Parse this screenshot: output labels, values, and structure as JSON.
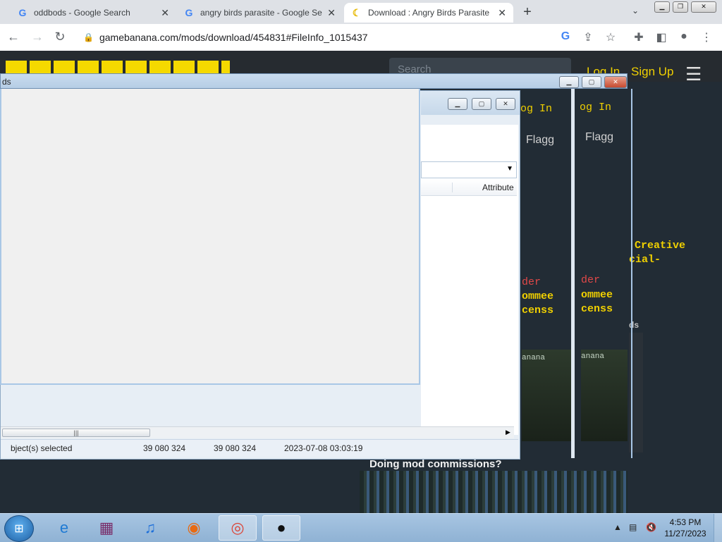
{
  "browser": {
    "tabs": [
      {
        "title": "oddbods - Google Search",
        "icon": "google-icon"
      },
      {
        "title": "angry birds parasite - Google Se",
        "icon": "google-icon"
      },
      {
        "title": "Download : Angry Birds Parasite",
        "icon": "banana-icon"
      }
    ],
    "new_tab": "+",
    "url": "gamebanana.com/mods/download/454831#FileInfo_1015437"
  },
  "page": {
    "search_placeholder": "Search",
    "login": "Log In",
    "signup": "Sign Up",
    "glitch": {
      "log_in": "og In",
      "flagged": "Flagg",
      "creative": "Creative",
      "official": "cial-",
      "order": "der",
      "commee": "ommee",
      "licens": "censs",
      "ds": "ds",
      "banana": "anana"
    },
    "commissions": "Doing mod commissions?"
  },
  "explorer": {
    "front_title": "ds",
    "column_attribute": "Attribute",
    "status": {
      "selected": "bject(s) selected",
      "size1": "39 080 324",
      "size2": "39 080 324",
      "date": "2023-07-08 03:03:19"
    }
  },
  "taskbar": {
    "apps": [
      "internet-explorer-icon",
      "winrar-icon",
      "itunes-icon",
      "firefox-icon",
      "chrome-icon",
      "angry-birds-icon"
    ],
    "time": "4:53 PM",
    "date": "11/27/2023"
  }
}
